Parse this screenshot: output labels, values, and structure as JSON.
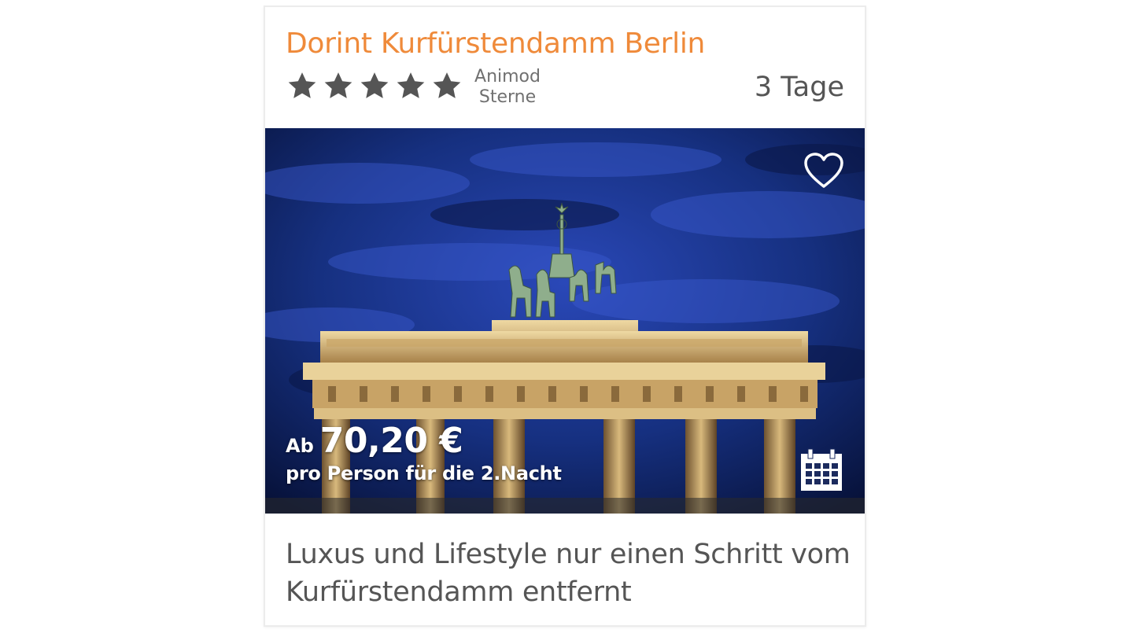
{
  "hotel": {
    "title": "Dorint Kurfürstendamm Berlin",
    "rating_value": 5,
    "rating_max": 5,
    "rating_label_line1": "Animod",
    "rating_label_line2": "Sterne",
    "duration": "3 Tage"
  },
  "offer": {
    "price_prefix": "Ab",
    "price": "70,20 €",
    "price_note": "pro Person für die 2.Nacht"
  },
  "description": "Luxus und Lifestyle nur einen Schritt vom Kurfürstendamm entfernt",
  "icons": {
    "favorite": "heart-outline-icon",
    "calendar": "calendar-icon",
    "star": "star-icon"
  },
  "colors": {
    "title": "#ef8a3a",
    "star": "#555555",
    "text": "#555555",
    "overlay_text": "#ffffff"
  }
}
